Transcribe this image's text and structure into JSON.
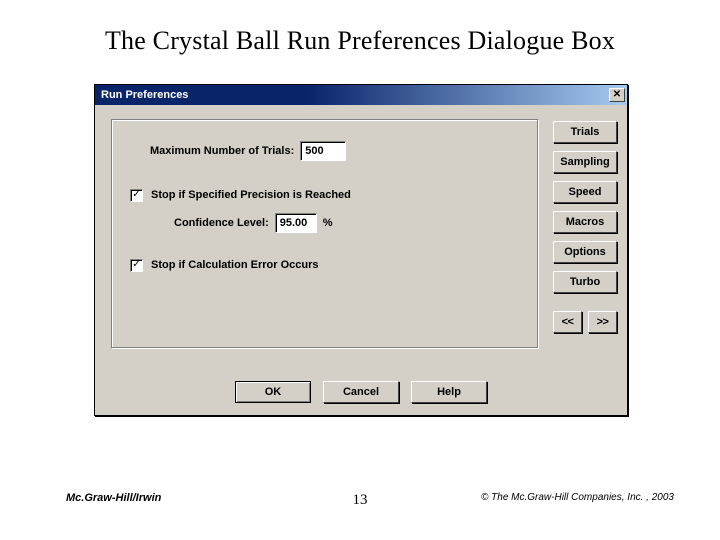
{
  "title": "The Crystal Ball Run Preferences Dialogue Box",
  "dialog": {
    "title": "Run Preferences",
    "close_glyph": "✕",
    "labels": {
      "max_trials": "Maximum Number of Trials:",
      "stop_precision": "Stop if Specified Precision is Reached",
      "confidence": "Confidence Level:",
      "stop_calc_error": "Stop if Calculation Error Occurs",
      "percent": "%"
    },
    "fields": {
      "max_trials_value": "500",
      "confidence_value": "95.00"
    },
    "checks": {
      "stop_precision": "✓",
      "stop_calc_error": "✓"
    },
    "side_buttons": {
      "b0": "Trials",
      "b1": "Sampling",
      "b2": "Speed",
      "b3": "Macros",
      "b4": "Options",
      "b5": "Turbo"
    },
    "nav": {
      "prev": "<<",
      "next": ">>"
    },
    "bottom": {
      "ok": "OK",
      "cancel": "Cancel",
      "help": "Help"
    }
  },
  "footer": {
    "left": "Mc.Graw-Hill/Irwin",
    "page": "13",
    "right": "© The Mc.Graw-Hill Companies, Inc. , 2003"
  }
}
